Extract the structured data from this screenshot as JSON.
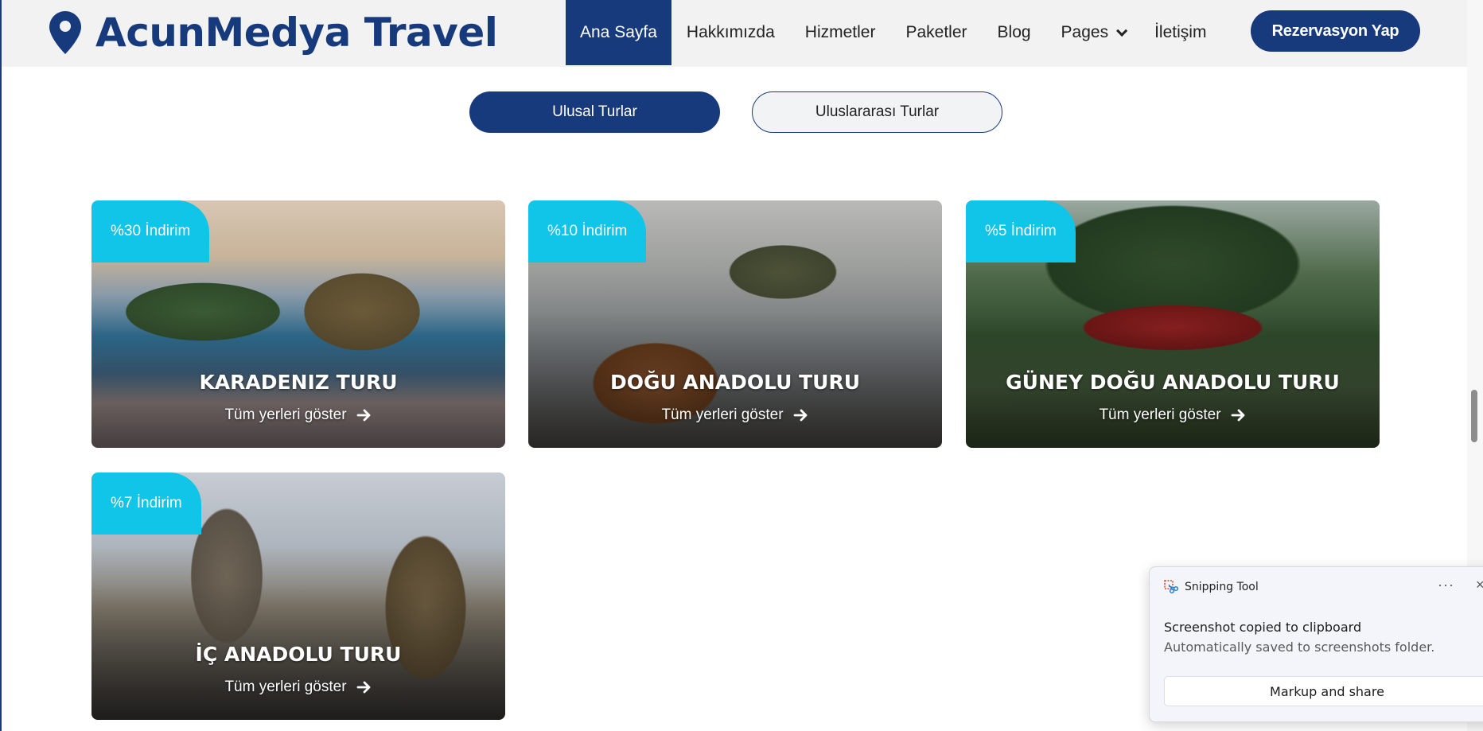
{
  "brand": {
    "name": "AcunMedya Travel",
    "color": "#173a7d",
    "accent": "#11c5e8"
  },
  "nav": {
    "items": [
      {
        "label": "Ana Sayfa",
        "active": true
      },
      {
        "label": "Hakkımızda"
      },
      {
        "label": "Hizmetler"
      },
      {
        "label": "Paketler"
      },
      {
        "label": "Blog"
      },
      {
        "label": "Pages",
        "dropdown": true
      },
      {
        "label": "İletişim"
      }
    ],
    "cta": "Rezervasyon Yap"
  },
  "tabs": [
    {
      "label": "Ulusal Turlar",
      "selected": true
    },
    {
      "label": "Uluslararası Turlar",
      "selected": false
    }
  ],
  "cards": [
    {
      "badge": "%30 İndirim",
      "title": "KARADENIZ TURU",
      "link": "Tüm yerleri göster"
    },
    {
      "badge": "%10 İndirim",
      "title": "DOĞU ANADOLU TURU",
      "link": "Tüm yerleri göster"
    },
    {
      "badge": "%5 İndirim",
      "title": "GÜNEY DOĞU ANADOLU TURU",
      "link": "Tüm yerleri göster"
    },
    {
      "badge": "%7 İndirim",
      "title": "İÇ ANADOLU TURU",
      "link": "Tüm yerleri göster"
    }
  ],
  "toast": {
    "app": "Snipping Tool",
    "more": "···",
    "close": "×",
    "title": "Screenshot copied to clipboard",
    "subtitle": "Automatically saved to screenshots folder.",
    "button": "Markup and share"
  }
}
